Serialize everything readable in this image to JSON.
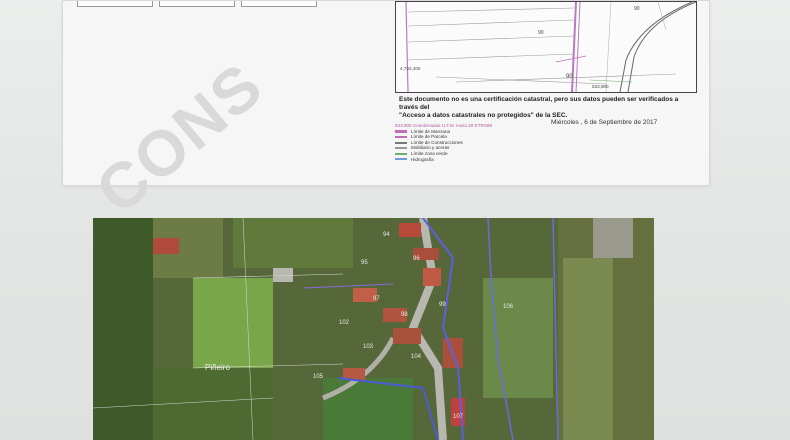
{
  "watermark": {
    "text": "CONS"
  },
  "disclaimer": {
    "line1": "Este documento no es una certificación catastral, pero sus datos pueden ser verificados a través del",
    "line2": "\"Acceso a datos catastrales no protegidos\" de la SEC."
  },
  "legend": {
    "coord": "533,900   Coordenadas U.T.M. Huso 29 ETRS89",
    "items": [
      {
        "label": "Límite de Manzana",
        "color": "#c06cb8"
      },
      {
        "label": "Límite de Parcela",
        "color": "#c06cb8"
      },
      {
        "label": "Límite de Construcciones",
        "color": "#777777"
      },
      {
        "label": "Mobiliario y aceras",
        "color": "#999999"
      },
      {
        "label": "Límite zona verde",
        "color": "#6ab06a"
      },
      {
        "label": "Hidrografía",
        "color": "#6a9ad8"
      }
    ]
  },
  "date": {
    "text": "Miércoles , 6 de Septiembre de 2017"
  },
  "map1": {
    "coord_left": "4,732,400",
    "coord_bottom": "533,900",
    "parcels": [
      "90",
      "90",
      "90"
    ]
  },
  "photo": {
    "place_label": "Piñeiro",
    "labels": [
      "94",
      "95",
      "96",
      "97",
      "98",
      "99",
      "102",
      "103",
      "104",
      "105",
      "106",
      "107"
    ]
  }
}
